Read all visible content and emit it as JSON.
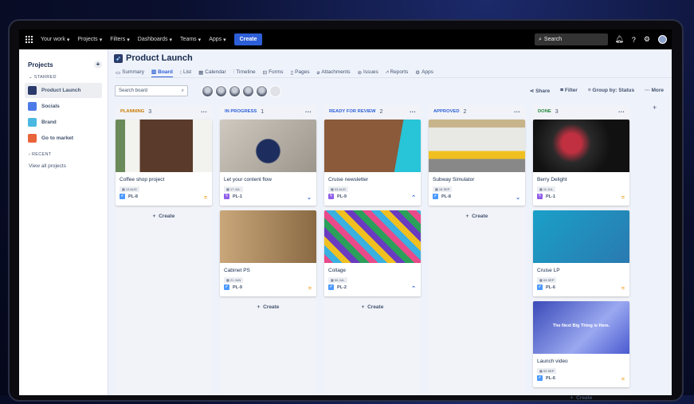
{
  "topnav": {
    "items": [
      "Your work",
      "Projects",
      "Filters",
      "Dashboards",
      "Teams",
      "Apps"
    ],
    "create": "Create",
    "search": "Search"
  },
  "sidebar": {
    "title": "Projects",
    "starred": "STARRED",
    "projects": [
      "Product Launch",
      "Socials",
      "Brand",
      "Go to market"
    ],
    "recent": "RECENT",
    "view_all": "View all projects"
  },
  "project": {
    "title": "Product Launch",
    "tabs": [
      "Summary",
      "Board",
      "List",
      "Calendar",
      "Timeline",
      "Forms",
      "Pages",
      "Attachments",
      "Issues",
      "Reports",
      "Apps"
    ],
    "active_tab": "Board"
  },
  "toolbar": {
    "search_placeholder": "Search board",
    "share": "Share",
    "filter": "Filter",
    "group_by": "Group by: Status",
    "more": "More"
  },
  "create_label": "Create",
  "columns": [
    {
      "name": "PLANNING",
      "count": "3",
      "color": "#c97a00",
      "cards": [
        {
          "title": "Coffee shop project",
          "date": "13 AUG",
          "key": "PL-8",
          "type": "task",
          "priority": "medium"
        }
      ]
    },
    {
      "name": "IN PROGRESS",
      "count": "1",
      "color": "#2d5fd8",
      "cards": [
        {
          "title": "Let your content flow",
          "date": "17 JUL",
          "key": "PL-1",
          "type": "epic",
          "priority": "low"
        },
        {
          "title": "Cabinet PS",
          "date": "21 JUN",
          "key": "PL-9",
          "type": "task",
          "priority": "medium"
        }
      ]
    },
    {
      "name": "READY FOR REVIEW",
      "count": "2",
      "color": "#2d5fd8",
      "cards": [
        {
          "title": "Cruise newsletter",
          "date": "03 AUG",
          "key": "PL-9",
          "type": "epic",
          "priority": "high"
        },
        {
          "title": "Collage",
          "date": "09 JUL",
          "key": "PL-2",
          "type": "task",
          "priority": "high"
        }
      ]
    },
    {
      "name": "APPROVED",
      "count": "2",
      "color": "#2d5fd8",
      "cards": [
        {
          "title": "Subway Simulator",
          "date": "18 SEP",
          "key": "PL-8",
          "type": "task",
          "priority": "low"
        }
      ]
    },
    {
      "name": "DONE",
      "count": "3",
      "color": "#22863a",
      "cards": [
        {
          "title": "Berry Delight",
          "date": "11 JUL",
          "key": "PL-1",
          "type": "epic",
          "priority": "medium"
        },
        {
          "title": "Cruise LP",
          "date": "03 SEP",
          "key": "PL-6",
          "type": "task",
          "priority": "medium"
        },
        {
          "title": "Launch video",
          "date": "03 SEP",
          "key": "PL-6",
          "type": "task",
          "priority": "medium",
          "image_text": "The Next Big Thing is Here."
        }
      ]
    }
  ]
}
